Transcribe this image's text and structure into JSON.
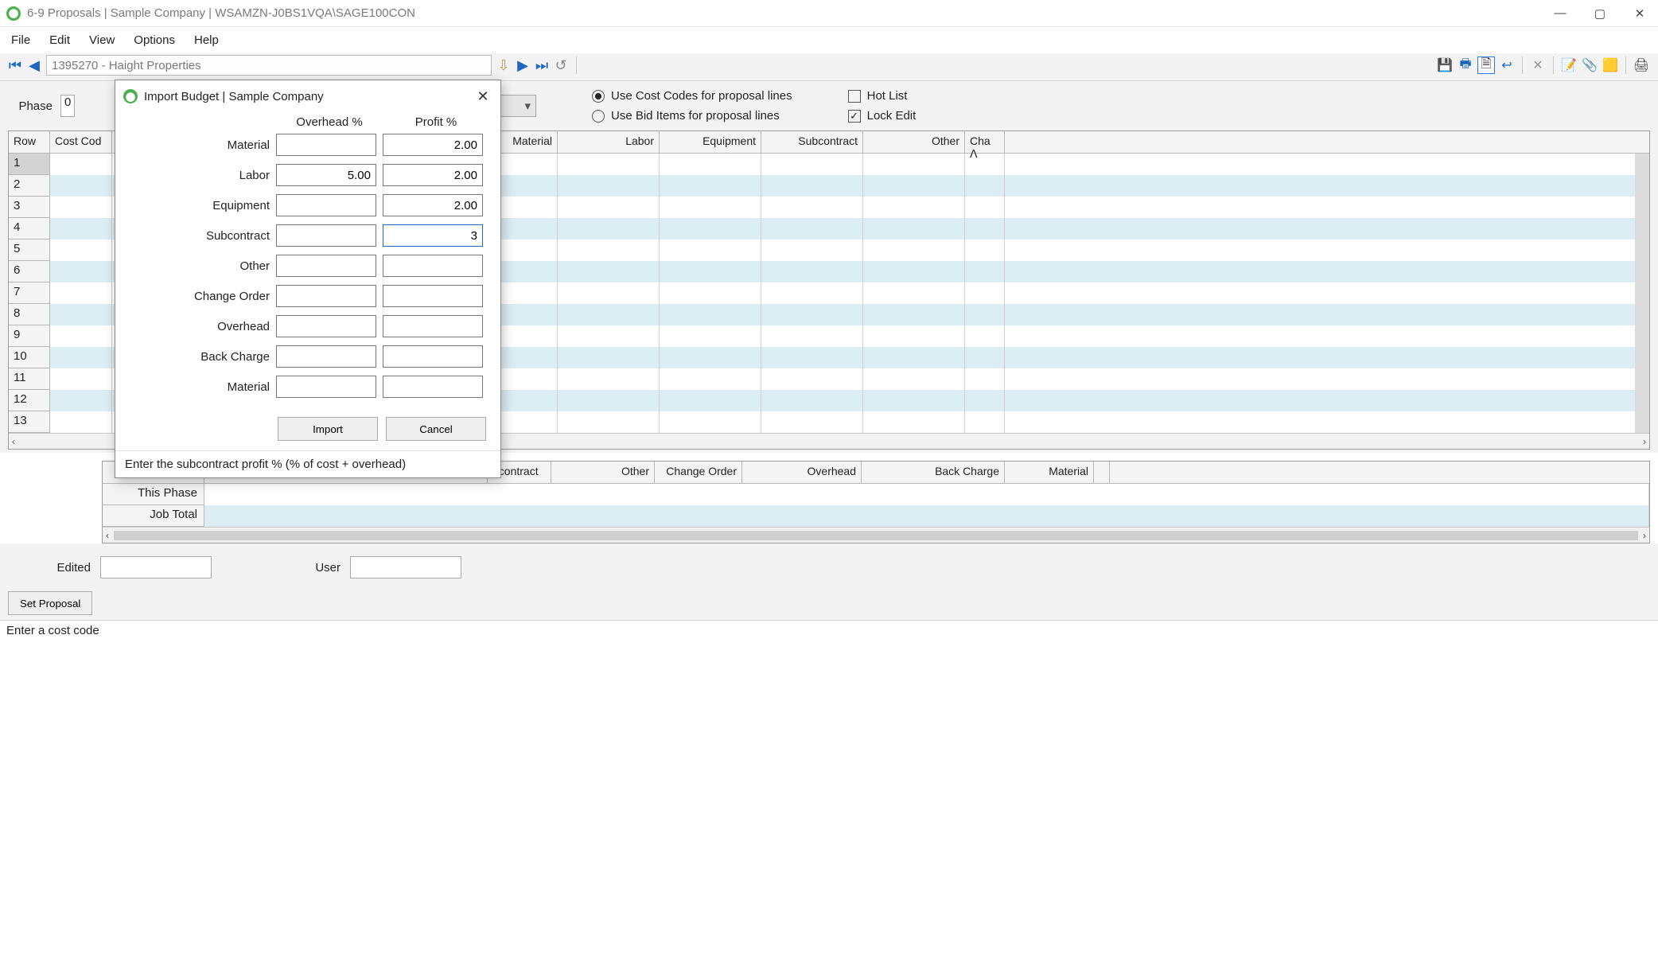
{
  "titlebar": {
    "text": "6-9 Proposals  |  Sample Company  |  WSAMZN-J0BS1VQA\\SAGE100CON"
  },
  "menu": {
    "file": "File",
    "edit": "Edit",
    "view": "View",
    "options": "Options",
    "help": "Help"
  },
  "record": {
    "value": "1395270 - Haight Properties"
  },
  "form": {
    "phase_label": "Phase",
    "phase_value": "0",
    "radio_cost_codes": "Use Cost Codes for proposal lines",
    "radio_bid_items": "Use Bid Items for proposal lines",
    "hot_list": "Hot List",
    "lock_edit": "Lock Edit"
  },
  "grid": {
    "headers": {
      "row": "Row",
      "cost_code": "Cost Cod",
      "material": "Material",
      "labor": "Labor",
      "equipment": "Equipment",
      "subcontract": "Subcontract",
      "other": "Other",
      "cha": "Cha"
    },
    "scroll_up": "ᐱ",
    "rows": [
      "1",
      "2",
      "3",
      "4",
      "5",
      "6",
      "7",
      "8",
      "9",
      "10",
      "11",
      "12",
      "13"
    ]
  },
  "summary": {
    "headers": {
      "bcontract": "bcontract",
      "other": "Other",
      "change_order": "Change Order",
      "overhead": "Overhead",
      "back_charge": "Back Charge",
      "material": "Material"
    },
    "rows": {
      "this_phase": "This Phase",
      "job_total": "Job Total"
    }
  },
  "bottom": {
    "edited_label": "Edited",
    "user_label": "User",
    "set_proposal": "Set Proposal"
  },
  "statusbar": {
    "text": "Enter a cost code"
  },
  "modal": {
    "title": "Import Budget  |  Sample Company",
    "col_overhead": "Overhead %",
    "col_profit": "Profit %",
    "rows": [
      {
        "label": "Material",
        "overhead": "",
        "profit": "2.00"
      },
      {
        "label": "Labor",
        "overhead": "5.00",
        "profit": "2.00"
      },
      {
        "label": "Equipment",
        "overhead": "",
        "profit": "2.00"
      },
      {
        "label": "Subcontract",
        "overhead": "",
        "profit": "3",
        "active": true
      },
      {
        "label": "Other",
        "overhead": "",
        "profit": ""
      },
      {
        "label": "Change Order",
        "overhead": "",
        "profit": ""
      },
      {
        "label": "Overhead",
        "overhead": "",
        "profit": ""
      },
      {
        "label": "Back Charge",
        "overhead": "",
        "profit": ""
      },
      {
        "label": "Material",
        "overhead": "",
        "profit": ""
      }
    ],
    "import": "Import",
    "cancel": "Cancel",
    "status": "Enter the subcontract profit % (% of cost + overhead)"
  }
}
